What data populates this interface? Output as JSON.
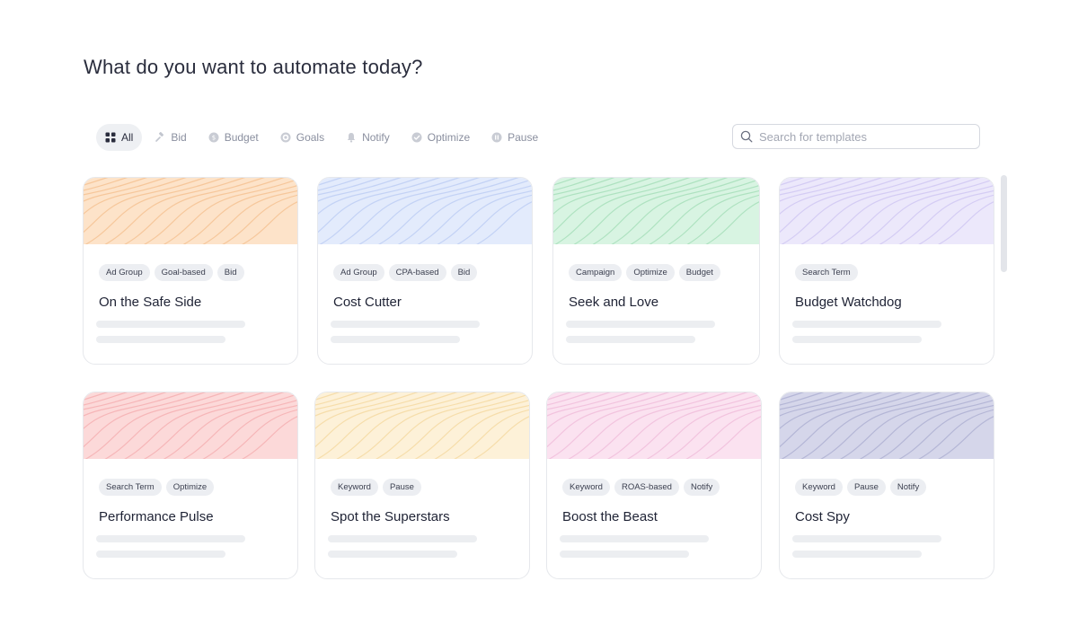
{
  "header": {
    "title": "What do you want to automate today?"
  },
  "filters": [
    {
      "label": "All",
      "icon": "grid-icon",
      "active": true
    },
    {
      "label": "Bid",
      "icon": "gavel-icon"
    },
    {
      "label": "Budget",
      "icon": "coin-icon"
    },
    {
      "label": "Goals",
      "icon": "target-icon"
    },
    {
      "label": "Notify",
      "icon": "bell-icon"
    },
    {
      "label": "Optimize",
      "icon": "check-circle-icon"
    },
    {
      "label": "Pause",
      "icon": "pause-icon"
    }
  ],
  "search": {
    "placeholder": "Search for templates",
    "value": "",
    "icon": "search-icon"
  },
  "cards": [
    {
      "title": "On the Safe Side",
      "tags": [
        "Ad Group",
        "Goal-based",
        "Bid"
      ],
      "color": "#fde3c9",
      "line_color": "#f6c79b"
    },
    {
      "title": "Cost Cutter",
      "tags": [
        "Ad Group",
        "CPA-based",
        "Bid"
      ],
      "color": "#e3ebfc",
      "line_color": "#c3d2f5"
    },
    {
      "title": "Seek and Love",
      "tags": [
        "Campaign",
        "Optimize",
        "Budget"
      ],
      "color": "#d8f4e2",
      "line_color": "#aee2c0"
    },
    {
      "title": "Budget Watchdog",
      "tags": [
        "Search Term"
      ],
      "color": "#ece8fb",
      "line_color": "#d4ccf4"
    },
    {
      "title": "Performance Pulse",
      "tags": [
        "Search Term",
        "Optimize"
      ],
      "color": "#fcd9d9",
      "line_color": "#f6b6b8"
    },
    {
      "title": "Spot the Superstars",
      "tags": [
        "Keyword",
        "Pause"
      ],
      "color": "#fdf1d8",
      "line_color": "#f6ddaa"
    },
    {
      "title": "Boost the Beast",
      "tags": [
        "Keyword",
        "ROAS-based",
        "Notify"
      ],
      "color": "#fbe2f0",
      "line_color": "#f2c3de"
    },
    {
      "title": "Cost Spy",
      "tags": [
        "Keyword",
        "Pause",
        "Notify"
      ],
      "color": "#d5d6ea",
      "line_color": "#b4b6d6"
    }
  ]
}
